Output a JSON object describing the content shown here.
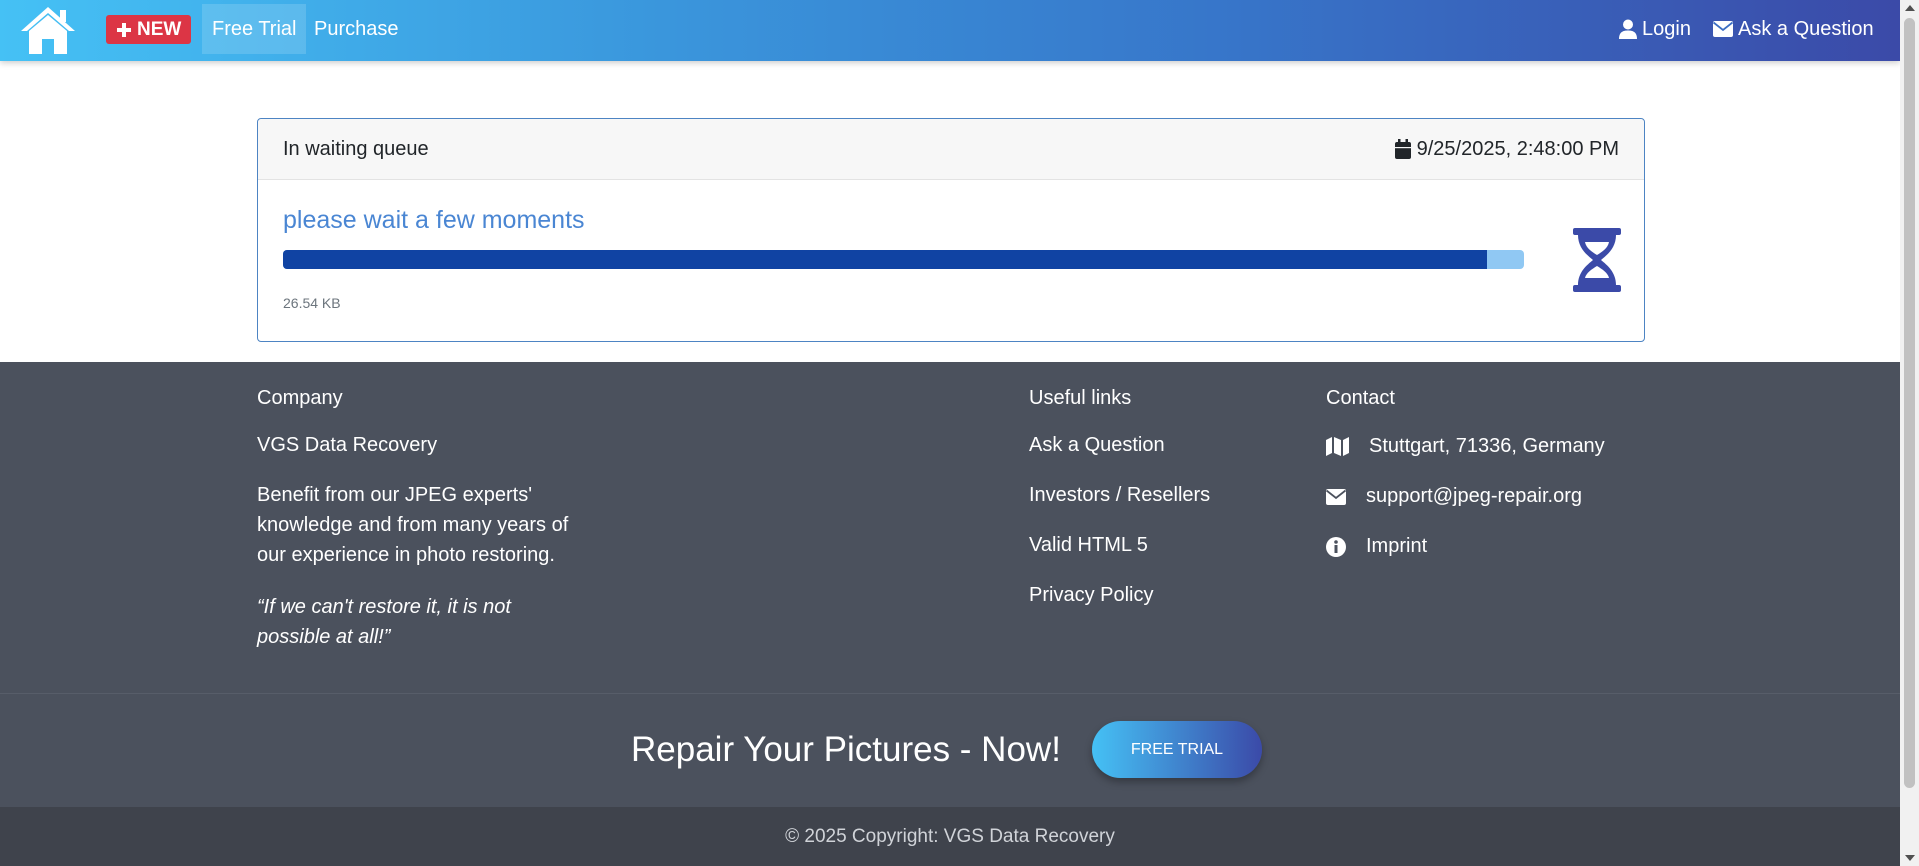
{
  "nav": {
    "home_icon": "house-icon",
    "new_label": "NEW",
    "new_icon": "plus-icon",
    "free_trial_label": "Free Trial",
    "purchase_label": "Purchase",
    "login_label": "Login",
    "login_icon": "user-icon",
    "ask_label": "Ask a Question",
    "ask_icon": "envelope-icon"
  },
  "queue_card": {
    "status": "In waiting queue",
    "date": "9/25/2025, 2:48:00 PM",
    "date_icon": "calendar-icon",
    "message": "please wait a few moments",
    "progress_fraction": 0.97,
    "file_size": "26.54 KB",
    "status_icon": "hourglass-icon"
  },
  "footer": {
    "company": {
      "heading": "Company",
      "name": "VGS Data Recovery",
      "desc_lines": [
        "Benefit from our JPEG experts'",
        "knowledge and from many years of",
        "our experience in photo restoring."
      ],
      "quote_lines": [
        "“If we can't restore it, it is not",
        "possible at all!”"
      ]
    },
    "useful_links": {
      "heading": "Useful links",
      "links": [
        "Ask a Question",
        "Investors / Resellers",
        "Valid HTML 5",
        "Privacy Policy"
      ]
    },
    "contact": {
      "heading": "Contact",
      "address": "Stuttgart, 71336, Germany",
      "address_icon": "map-icon",
      "email": "support@jpeg-repair.org",
      "email_icon": "envelope-icon",
      "imprint": "Imprint",
      "imprint_icon": "info-circle-icon"
    }
  },
  "cta": {
    "text": "Repair Your Pictures - Now!",
    "button_label": "FREE TRIAL"
  },
  "copyright": "© 2025 Copyright: VGS Data Recovery",
  "colors": {
    "nav_gradient_start": "#45c1f5",
    "nav_gradient_end": "#3b4aa8",
    "new_badge": "#dc3545",
    "progress_fill": "#1043a3",
    "progress_track": "#90c8f3",
    "message_text": "#4a86d3",
    "hourglass": "#3b4aa8",
    "footer_bg": "#4b515d",
    "copyright_bg": "#3f434c"
  }
}
